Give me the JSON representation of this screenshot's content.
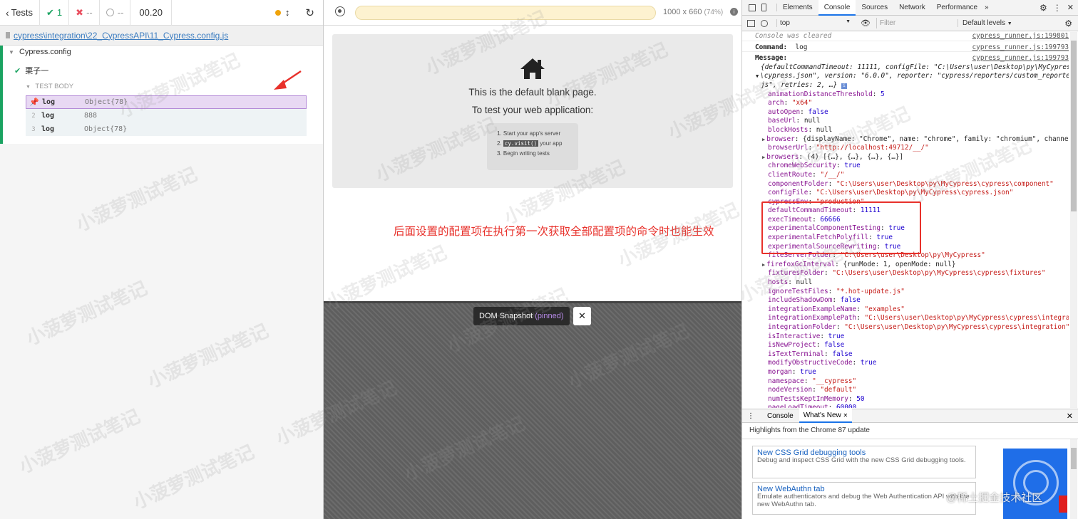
{
  "reporter": {
    "back_label": "Tests",
    "passed": "1",
    "failed": "--",
    "pending": "--",
    "duration": "00.20",
    "spec_path": "cypress\\integration\\22_CypressAPI\\11_Cypress.config.js",
    "suite_title": "Cypress.config",
    "test_title": "栗子一",
    "section_title": "TEST BODY",
    "commands": [
      {
        "num": "",
        "name": "log",
        "message": "Object{78}"
      },
      {
        "num": "2",
        "name": "log",
        "message": "888"
      },
      {
        "num": "3",
        "name": "log",
        "message": "Object{78}"
      }
    ]
  },
  "aut": {
    "viewport": "1000 x 660",
    "zoom": "(74%)",
    "blank_line1": "This is the default blank page.",
    "blank_line2": "To test your web application:",
    "steps": [
      "Start your app's server",
      "your app",
      "Begin writing tests"
    ],
    "step_code": "cy.visit()",
    "annotation": "后面设置的配置项在执行第一次获取全部配置项的命令时也能生效",
    "snapshot_label": "DOM Snapshot",
    "snapshot_pinned": "(pinned)"
  },
  "devtools": {
    "tabs": [
      "Elements",
      "Console",
      "Sources",
      "Network",
      "Performance"
    ],
    "context": "top",
    "filter_placeholder": "Filter",
    "levels": "Default levels",
    "cleared": "Console was cleared",
    "source1": "cypress_runner.js:199801",
    "source2": "cypress_runner.js:199793",
    "command_label": "Command:",
    "command_value": "log",
    "message_label": "Message:",
    "summary_line1": "{defaultCommandTimeout: 11111, configFile: \"C:\\Users\\user\\Desktop\\py\\MyCypress",
    "summary_line2": "\\cypress.json\", version: \"6.0.0\", reporter: \"cypress/reporters/custom_reporter.",
    "summary_line3": "js\", retries: 2, …}",
    "props": [
      {
        "k": "animationDistanceThreshold",
        "v": "5",
        "t": "n"
      },
      {
        "k": "arch",
        "v": "\"x64\"",
        "t": "s"
      },
      {
        "k": "autoOpen",
        "v": "false",
        "t": "n"
      },
      {
        "k": "baseUrl",
        "v": "null",
        "t": "p"
      },
      {
        "k": "blockHosts",
        "v": "null",
        "t": "p"
      },
      {
        "k": "browser",
        "v": "{displayName: \"Chrome\", name: \"chrome\", family: \"chromium\", channel…",
        "t": "p",
        "exp": true
      },
      {
        "k": "browserUrl",
        "v": "\"http://localhost:49712/__/\"",
        "t": "s"
      },
      {
        "k": "browsers",
        "v": "(4) [{…}, {…}, {…}, {…}]",
        "t": "p",
        "exp": true
      },
      {
        "k": "chromeWebSecurity",
        "v": "true",
        "t": "n"
      },
      {
        "k": "clientRoute",
        "v": "\"/__/\"",
        "t": "s"
      },
      {
        "k": "componentFolder",
        "v": "\"C:\\Users\\user\\Desktop\\py\\MyCypress\\cypress\\component\"",
        "t": "s"
      },
      {
        "k": "configFile",
        "v": "\"C:\\Users\\user\\Desktop\\py\\MyCypress\\cypress.json\"",
        "t": "s"
      },
      {
        "k": "cypressEnv",
        "v": "\"production\"",
        "t": "s"
      },
      {
        "k": "defaultCommandTimeout",
        "v": "11111",
        "t": "n"
      },
      {
        "k": "execTimeout",
        "v": "66666",
        "t": "n"
      },
      {
        "k": "experimentalComponentTesting",
        "v": "true",
        "t": "n"
      },
      {
        "k": "experimentalFetchPolyfill",
        "v": "true",
        "t": "n"
      },
      {
        "k": "experimentalSourceRewriting",
        "v": "true",
        "t": "n"
      },
      {
        "k": "fileServerFolder",
        "v": "\"C:\\Users\\user\\Desktop\\py\\MyCypress\"",
        "t": "s"
      },
      {
        "k": "firefoxGcInterval",
        "v": "{runMode: 1, openMode: null}",
        "t": "p",
        "exp": true
      },
      {
        "k": "fixturesFolder",
        "v": "\"C:\\Users\\user\\Desktop\\py\\MyCypress\\cypress\\fixtures\"",
        "t": "s"
      },
      {
        "k": "hosts",
        "v": "null",
        "t": "p"
      },
      {
        "k": "ignoreTestFiles",
        "v": "\"*.hot-update.js\"",
        "t": "s"
      },
      {
        "k": "includeShadowDom",
        "v": "false",
        "t": "n"
      },
      {
        "k": "integrationExampleName",
        "v": "\"examples\"",
        "t": "s"
      },
      {
        "k": "integrationExamplePath",
        "v": "\"C:\\Users\\user\\Desktop\\py\\MyCypress\\cypress\\integrat…",
        "t": "s"
      },
      {
        "k": "integrationFolder",
        "v": "\"C:\\Users\\user\\Desktop\\py\\MyCypress\\cypress\\integration\"",
        "t": "s"
      },
      {
        "k": "isInteractive",
        "v": "true",
        "t": "n"
      },
      {
        "k": "isNewProject",
        "v": "false",
        "t": "n"
      },
      {
        "k": "isTextTerminal",
        "v": "false",
        "t": "n"
      },
      {
        "k": "modifyObstructiveCode",
        "v": "true",
        "t": "n"
      },
      {
        "k": "morgan",
        "v": "true",
        "t": "n"
      },
      {
        "k": "namespace",
        "v": "\"__cypress\"",
        "t": "s"
      },
      {
        "k": "nodeVersion",
        "v": "\"default\"",
        "t": "s"
      },
      {
        "k": "numTestsKeptInMemory",
        "v": "50",
        "t": "n"
      },
      {
        "k": "pageLoadTimeout",
        "v": "60000",
        "t": "n"
      }
    ],
    "drawer_tabs": [
      "Console",
      "What's New"
    ],
    "highlights": "Highlights from the Chrome 87 update",
    "cards": [
      {
        "title": "New CSS Grid debugging tools",
        "desc": "Debug and inspect CSS Grid with the new CSS Grid debugging tools."
      },
      {
        "title": "New WebAuthn tab",
        "desc": "Emulate authenticators and debug the Web Authentication API with the new WebAuthn tab."
      }
    ]
  },
  "watermark": "小菠萝测试笔记",
  "credit": "@稀土掘金技术社区"
}
